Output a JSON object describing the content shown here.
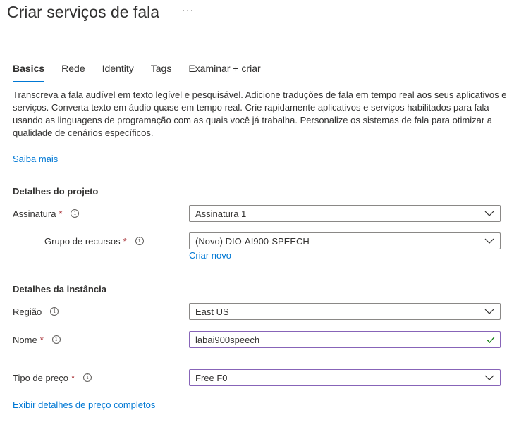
{
  "header": {
    "title": "Criar serviços de fala",
    "more_label": "···"
  },
  "tabs": [
    {
      "label": "Basics",
      "active": true
    },
    {
      "label": "Rede"
    },
    {
      "label": "Identity"
    },
    {
      "label": "Tags"
    },
    {
      "label": "Examinar + criar"
    }
  ],
  "intro": {
    "description": "Transcreva a fala audível em texto legível e pesquisável. Adicione traduções de fala em tempo real aos seus aplicativos e serviços. Converta texto em áudio quase em tempo real. Crie rapidamente aplicativos e serviços habilitados para fala usando as linguagens de programação com as quais você já trabalha. Personalize os sistemas de fala para otimizar a qualidade de cenários específicos.",
    "learn_more": "Saiba mais"
  },
  "project": {
    "heading": "Detalhes do projeto",
    "subscription": {
      "label": "Assinatura",
      "required": "*",
      "value": "Assinatura 1"
    },
    "resource_group": {
      "label": "Grupo de recursos",
      "required": "*",
      "value": "(Novo) DIO-AI900-SPEECH",
      "create_new": "Criar novo"
    }
  },
  "instance": {
    "heading": "Detalhes da instância",
    "region": {
      "label": "Região",
      "value": "East US"
    },
    "name": {
      "label": "Nome",
      "required": "*",
      "value": "labai900speech"
    },
    "pricing": {
      "label": "Tipo de preço",
      "required": "*",
      "value": "Free F0"
    },
    "pricing_link": "Exibir detalhes de preço completos"
  },
  "colors": {
    "accent": "#0078d4",
    "required": "#a4262c",
    "valid": "#107c10",
    "focus_border": "#8764b8"
  }
}
